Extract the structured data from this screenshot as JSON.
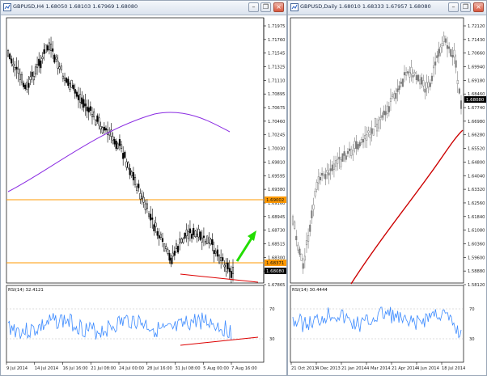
{
  "colors": {
    "bull": "#000000",
    "bear": "#000000",
    "grid_line": "#000000",
    "ma_a": "#8a2be2",
    "ma_b": "#cc0000",
    "hline": "#ff9900",
    "trend": "#dd0000",
    "arrow": "#22dd00",
    "rsi": "#3d8bff",
    "price_tag": "#000000",
    "level_tag": "#ff9900",
    "candle_gray": "#808080"
  },
  "icons": [
    "chart-icon",
    "minimize-icon",
    "restore-icon",
    "close-icon"
  ],
  "windows": [
    {
      "title": "GBPUSD,H4  1.68050 1.68103 1.67969 1.68080",
      "rsi_label": "RSI(14) 32.4121",
      "price_ticks": [
        "1.71975",
        "1.71760",
        "1.71545",
        "1.71325",
        "1.71110",
        "1.70895",
        "1.70675",
        "1.70460",
        "1.70245",
        "1.70030",
        "1.69810",
        "1.69595",
        "1.69380",
        "1.69160",
        "1.68945",
        "1.68730",
        "1.68515",
        "1.68300",
        "1.68080",
        "1.67865"
      ],
      "level_tag_upper": "1.69002",
      "level_tag_lower": "1.68371",
      "current_price_tag": "1.68080",
      "rsi_ticks": [
        "70",
        "30"
      ],
      "time_labels": [
        "9 Jul 2014",
        "14 Jul 2014",
        "16 Jul 16:00",
        "21 Jul 08:00",
        "24 Jul 00:00",
        "28 Jul 16:00",
        "31 Jul 08:00",
        "5 Aug 00:00",
        "7 Aug 16:00"
      ]
    },
    {
      "title": "GBPUSD,Daily  1.68010 1.68333 1.67957 1.68080",
      "rsi_label": "RSI(14) 30.4444",
      "price_ticks": [
        "1.72120",
        "1.71430",
        "1.70660",
        "1.69940",
        "1.69180",
        "1.68460",
        "1.67740",
        "1.66980",
        "1.66280",
        "1.65520",
        "1.64800",
        "1.64040",
        "1.63320",
        "1.62560",
        "1.61840",
        "1.61080",
        "1.60360",
        "1.59600",
        "1.58880",
        "1.58120"
      ],
      "current_price_tag": "1.68080",
      "rsi_ticks": [
        "70",
        "30"
      ],
      "time_labels": [
        "21 Oct 2013",
        "4 Dec 2013",
        "21 Jan 2014",
        "4 Mar 2014",
        "21 Apr 2014",
        "4 Jun 2014",
        "18 Jul 2014"
      ]
    }
  ]
}
